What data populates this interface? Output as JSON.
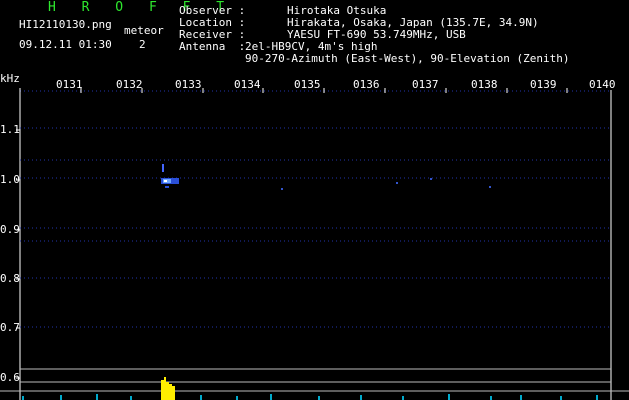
{
  "header": {
    "title": "H R O F F T",
    "filename": "HI12110130.png",
    "datetime": "09.12.11 01:30",
    "event_type": "meteor",
    "event_count": "2"
  },
  "observer": {
    "observer_label": "Observer :",
    "observer_value": "Hirotaka Otsuka",
    "location_label": "Location :",
    "location_value": "Hirakata, Osaka, Japan (135.7E, 34.9N)",
    "receiver_label": "Receiver :",
    "receiver_value": "YAESU FT-690 53.749MHz, USB",
    "antenna_label": "Antenna  :",
    "antenna_value": "2el-HB9CV, 4m's high",
    "antenna_value2": "90-270-Azimuth (East-West), 90-Elevation (Zenith)"
  },
  "axis": {
    "y_unit": "kHz",
    "x_ticks": [
      "0131",
      "0132",
      "0133",
      "0134",
      "0135",
      "0136",
      "0137",
      "0138",
      "0139",
      "0140"
    ],
    "y_ticks": [
      "1.1",
      "1.0",
      "0.9",
      "0.8",
      "0.7",
      "0.6"
    ]
  },
  "colors": {
    "title": "#2ee82e",
    "grid": "#2233aa",
    "signal": "#ffee00",
    "echo": "#6fa8ff",
    "baseline": "#00aacc"
  }
}
